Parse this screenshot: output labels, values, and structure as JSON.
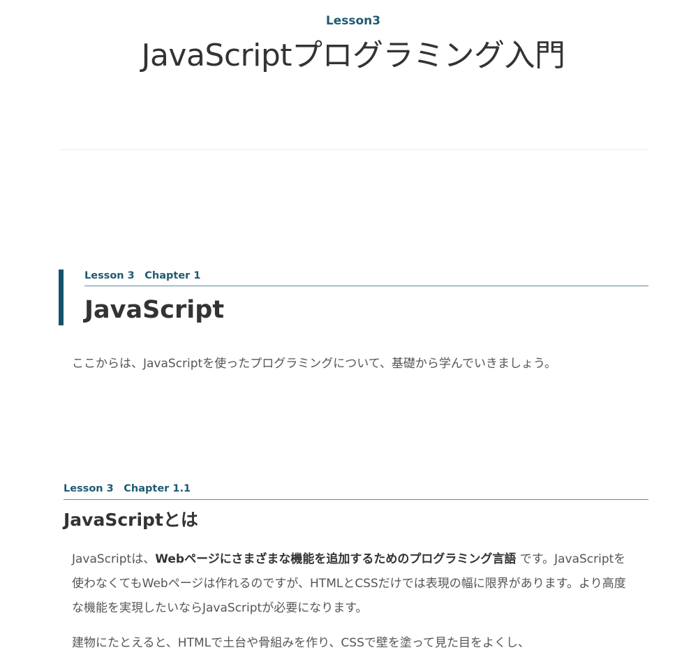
{
  "lesson_label": "Lesson3",
  "page_title": "JavaScriptプログラミング入門",
  "chapter1": {
    "breadcrumb": "Lesson 3　Chapter 1",
    "heading": "JavaScript",
    "text": "ここからは、JavaScriptを使ったプログラミングについて、基礎から学んでいきましょう。"
  },
  "chapter1_1": {
    "breadcrumb": "Lesson 3　Chapter 1.1",
    "heading": "JavaScriptとは",
    "para1_prefix": "JavaScriptは、",
    "para1_bold": "Webページにさまざまな機能を追加するためのプログラミング言語",
    "para1_suffix": " です。JavaScriptを使わなくてもWebページは作れるのですが、HTMLとCSSだけでは表現の幅に限界があります。より高度な機能を実現したいならJavaScriptが必要になります。",
    "para2": "建物にたとえると、HTMLで土台や骨組みを作り、CSSで壁を塗って見た目をよくし、"
  },
  "colors": {
    "accent": "#14536b",
    "label": "#1f5a73",
    "rule": "#5a8a9c",
    "heading_text": "#333333",
    "body_text": "#555555"
  }
}
